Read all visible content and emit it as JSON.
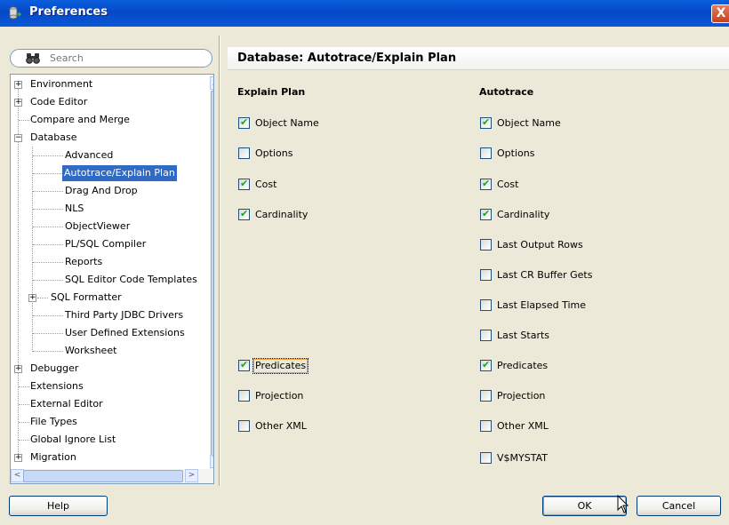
{
  "window": {
    "title": "Preferences",
    "close_glyph": "X"
  },
  "search": {
    "placeholder": "Search",
    "icon": "binoculars-icon"
  },
  "tree": {
    "items": [
      {
        "label": "Environment",
        "expander": "+"
      },
      {
        "label": "Code Editor",
        "expander": "+"
      },
      {
        "label": "Compare and Merge"
      },
      {
        "label": "Database",
        "expander": "-"
      },
      {
        "label": "Advanced"
      },
      {
        "label": "Autotrace/Explain Plan",
        "selected": true
      },
      {
        "label": "Drag And Drop"
      },
      {
        "label": "NLS"
      },
      {
        "label": "ObjectViewer"
      },
      {
        "label": "PL/SQL Compiler"
      },
      {
        "label": "Reports"
      },
      {
        "label": "SQL Editor Code Templates"
      },
      {
        "label": "SQL Formatter",
        "expander": "+"
      },
      {
        "label": "Third Party JDBC Drivers"
      },
      {
        "label": "User Defined Extensions"
      },
      {
        "label": "Worksheet"
      },
      {
        "label": "Debugger",
        "expander": "+"
      },
      {
        "label": "Extensions"
      },
      {
        "label": "External Editor"
      },
      {
        "label": "File Types"
      },
      {
        "label": "Global Ignore List"
      },
      {
        "label": "Migration",
        "expander": "+"
      }
    ]
  },
  "panel": {
    "title": "Database: Autotrace/Explain Plan",
    "explain_plan": {
      "heading": "Explain Plan",
      "options": [
        {
          "label": "Object Name",
          "checked": true
        },
        {
          "label": "Options",
          "checked": false
        },
        {
          "label": "Cost",
          "checked": true
        },
        {
          "label": "Cardinality",
          "checked": true
        },
        {
          "label": "Predicates",
          "checked": true,
          "focused": true
        },
        {
          "label": "Projection",
          "checked": false
        },
        {
          "label": "Other XML",
          "checked": false
        }
      ]
    },
    "autotrace": {
      "heading": "Autotrace",
      "options": [
        {
          "label": "Object Name",
          "checked": true
        },
        {
          "label": "Options",
          "checked": false
        },
        {
          "label": "Cost",
          "checked": true
        },
        {
          "label": "Cardinality",
          "checked": true
        },
        {
          "label": "Last Output Rows",
          "checked": false
        },
        {
          "label": "Last CR Buffer Gets",
          "checked": false
        },
        {
          "label": "Last Elapsed Time",
          "checked": false
        },
        {
          "label": "Last Starts",
          "checked": false
        },
        {
          "label": "Predicates",
          "checked": true
        },
        {
          "label": "Projection",
          "checked": false
        },
        {
          "label": "Other XML",
          "checked": false
        },
        {
          "label": "V$MYSTAT",
          "checked": false
        }
      ]
    }
  },
  "buttons": {
    "help": "Help",
    "ok": "OK",
    "cancel": "Cancel"
  },
  "colors": {
    "titlebar": "#0a5fdc",
    "selection": "#316ac5",
    "dialog_bg": "#ece9d8"
  }
}
